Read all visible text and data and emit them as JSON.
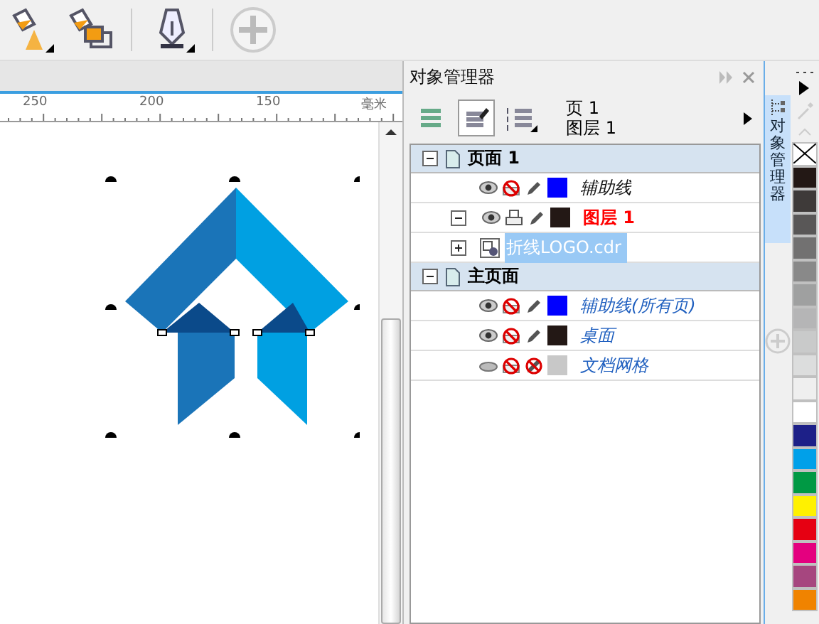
{
  "ruler": {
    "labels": [
      "250",
      "200",
      "150"
    ],
    "unit": "毫米"
  },
  "object_manager": {
    "title": "对象管理器",
    "current_page": "页 1",
    "current_layer": "图层 1",
    "pages": [
      {
        "name": "页面 1",
        "kind": "page",
        "expanded": true,
        "layers": [
          {
            "name": "辅助线",
            "kind": "guide",
            "active": false,
            "visible": true,
            "printable": false,
            "editable": true,
            "color": "#0000ff"
          },
          {
            "name": "图层 1",
            "kind": "layer",
            "active": true,
            "visible": true,
            "printable": true,
            "editable": true,
            "color": "#231815",
            "expanded": true,
            "objects": [
              {
                "name": "折线LOGO.cdr",
                "selected": true,
                "expanded": false
              }
            ]
          }
        ]
      },
      {
        "name": "主页面",
        "kind": "master",
        "expanded": true,
        "layers": [
          {
            "name": "辅助线(所有页)",
            "kind": "guide",
            "active": false,
            "visible": true,
            "printable": false,
            "editable": true,
            "color": "#0000ff"
          },
          {
            "name": "桌面",
            "kind": "guide",
            "active": false,
            "visible": true,
            "printable": false,
            "editable": true,
            "color": "#231815"
          },
          {
            "name": "文档网格",
            "kind": "guide",
            "active": false,
            "visible": false,
            "printable": false,
            "editable": false,
            "color": "#c8c8c8"
          }
        ]
      }
    ]
  },
  "docker_tab": {
    "label": "对象管理器",
    "selected": true
  },
  "palette": [
    {
      "kind": "none"
    },
    {
      "kind": "swatch",
      "color": "#231815"
    },
    {
      "kind": "swatch",
      "color": "#3e3a39"
    },
    {
      "kind": "swatch",
      "color": "#595757"
    },
    {
      "kind": "swatch",
      "color": "#727171"
    },
    {
      "kind": "swatch",
      "color": "#898989"
    },
    {
      "kind": "swatch",
      "color": "#9fa0a0"
    },
    {
      "kind": "swatch",
      "color": "#b5b5b6"
    },
    {
      "kind": "swatch",
      "color": "#c9caca"
    },
    {
      "kind": "swatch",
      "color": "#dcdddd"
    },
    {
      "kind": "swatch",
      "color": "#efefef"
    },
    {
      "kind": "swatch",
      "color": "#ffffff"
    },
    {
      "kind": "swatch",
      "color": "#1d2088"
    },
    {
      "kind": "swatch",
      "color": "#00a0e9"
    },
    {
      "kind": "swatch",
      "color": "#009944"
    },
    {
      "kind": "swatch",
      "color": "#fff100"
    },
    {
      "kind": "swatch",
      "color": "#e60012"
    },
    {
      "kind": "swatch",
      "color": "#e4007f"
    },
    {
      "kind": "swatch",
      "color": "#a6467f"
    },
    {
      "kind": "swatch",
      "color": "#f08300"
    }
  ]
}
